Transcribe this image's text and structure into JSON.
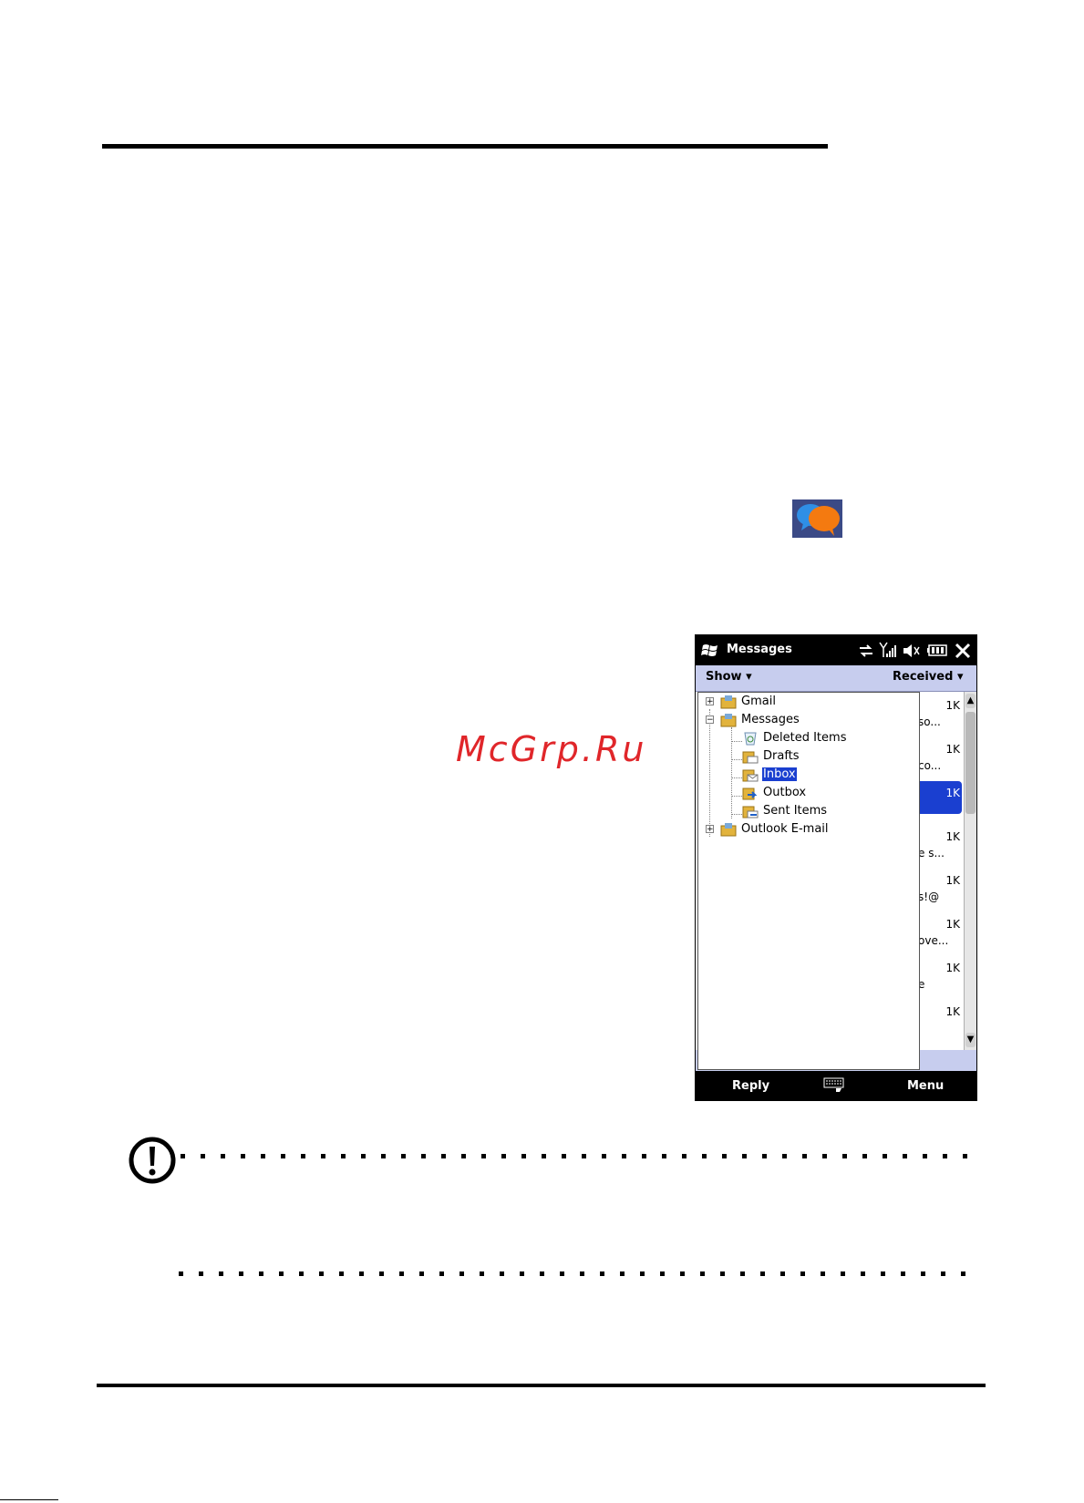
{
  "watermark": "McGrp.Ru",
  "phone": {
    "title": "Messages",
    "toolbar": {
      "left": "Show",
      "right": "Received"
    },
    "softkeys": {
      "left": "Reply",
      "right": "Menu"
    },
    "tree": [
      {
        "label": "Gmail",
        "level": 0,
        "expander": "+"
      },
      {
        "label": "Messages",
        "level": 0,
        "expander": "−"
      },
      {
        "label": "Deleted Items",
        "level": 1
      },
      {
        "label": "Drafts",
        "level": 1
      },
      {
        "label": "Inbox",
        "level": 1,
        "selected": true
      },
      {
        "label": "Outbox",
        "level": 1
      },
      {
        "label": "Sent Items",
        "level": 1
      },
      {
        "label": "Outlook E-mail",
        "level": 0,
        "expander": "+"
      }
    ],
    "list": [
      {
        "size": "1K",
        "snippet": "so..."
      },
      {
        "size": "1K",
        "snippet": "co..."
      },
      {
        "size": "1K",
        "snippet": "",
        "selected": true
      },
      {
        "size": "1K",
        "snippet": "e s..."
      },
      {
        "size": "1K",
        "snippet": "s!@"
      },
      {
        "size": "1K",
        "snippet": "ove..."
      },
      {
        "size": "1K",
        "snippet": "e"
      },
      {
        "size": "1K",
        "snippet": ""
      }
    ],
    "accent": "#1a3fd0",
    "toolbar_color": "#c7cdee"
  }
}
